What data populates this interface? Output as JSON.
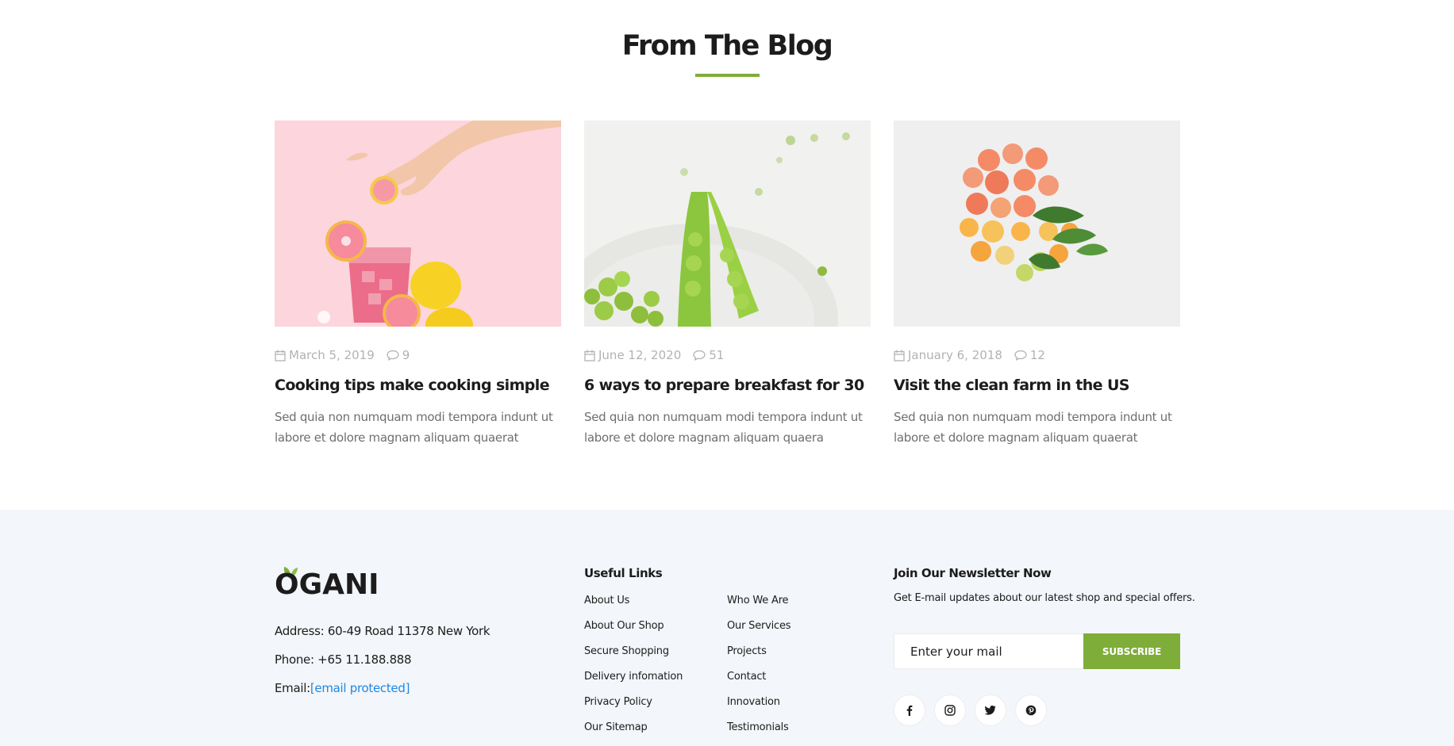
{
  "blog": {
    "title": "From The Blog",
    "accent_color": "#7fad39",
    "posts": [
      {
        "image": "pink-grapefruit-drink-photo",
        "date": "March 5, 2019",
        "comments": "9",
        "title": "Cooking tips make cooking simple",
        "excerpt": "Sed quia non numquam modi tempora indunt ut labore et dolore magnam aliquam quaerat"
      },
      {
        "image": "green-peas-pod-photo",
        "date": "June 12, 2020",
        "comments": "51",
        "title": "6 ways to prepare breakfast for 30",
        "excerpt": "Sed quia non numquam modi tempora indunt ut labore et dolore magnam aliquam quaera"
      },
      {
        "image": "citrus-slices-photo",
        "date": "January 6, 2018",
        "comments": "12",
        "title": "Visit the clean farm in the US",
        "excerpt": "Sed quia non numquam modi tempora indunt ut labore et dolore magnam aliquam quaerat"
      }
    ]
  },
  "footer": {
    "logo_text": "OGANI",
    "address": "Address: 60-49 Road 11378 New York",
    "phone": "Phone: +65 11.188.888",
    "email_label": "Email:",
    "email_value": "[email protected]",
    "useful_links": {
      "heading": "Useful Links",
      "col1": [
        "About Us",
        "About Our Shop",
        "Secure Shopping",
        "Delivery infomation",
        "Privacy Policy",
        "Our Sitemap"
      ],
      "col2": [
        "Who We Are",
        "Our Services",
        "Projects",
        "Contact",
        "Innovation",
        "Testimonials"
      ]
    },
    "newsletter": {
      "heading": "Join Our Newsletter Now",
      "text": "Get E-mail updates about our latest shop and special offers.",
      "placeholder": "Enter your mail",
      "button": "SUBSCRIBE"
    },
    "socials": [
      "facebook-icon",
      "instagram-icon",
      "twitter-icon",
      "pinterest-icon"
    ],
    "background_color": "#f3f6fa"
  }
}
